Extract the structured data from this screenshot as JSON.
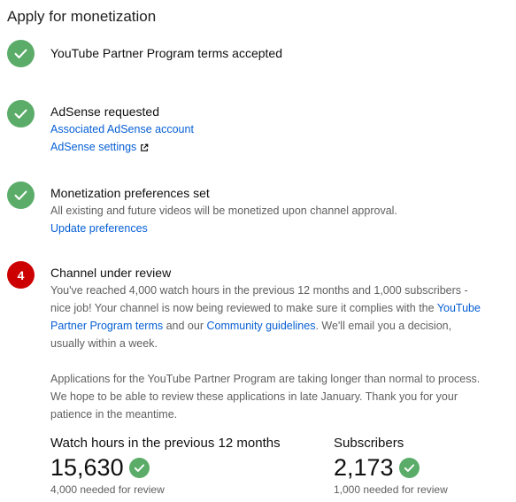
{
  "page": {
    "title": "Apply for monetization"
  },
  "colors": {
    "done": "#5bac69",
    "current": "#cc0000",
    "link": "#065fd4"
  },
  "steps": [
    {
      "status": "done",
      "icon": "check-icon",
      "title": "YouTube Partner Program terms accepted"
    },
    {
      "status": "done",
      "icon": "check-icon",
      "title": "AdSense requested",
      "links": [
        "Associated AdSense account",
        "AdSense settings"
      ]
    },
    {
      "status": "done",
      "icon": "check-icon",
      "title": "Monetization preferences set",
      "description": "All existing and future videos will be monetized upon channel approval.",
      "link": "Update preferences"
    },
    {
      "status": "current",
      "number": "4",
      "title": "Channel under review",
      "para1_part1": "You've reached 4,000 watch hours in the previous 12 months and 1,000 subscribers - nice job! Your channel is now being reviewed to make sure it complies with the ",
      "para1_link1": "YouTube Partner Program terms",
      "para1_part2": " and our ",
      "para1_link2": "Community guidelines",
      "para1_part3": ". We'll email you a decision, usually within a week.",
      "para2": "Applications for the YouTube Partner Program are taking longer than normal to process. We hope to be able to review these applications in late January. Thank you for your patience in the meantime."
    }
  ],
  "stats": {
    "watch_hours": {
      "label": "Watch hours in the previous 12 months",
      "value": "15,630",
      "note": "4,000 needed for review"
    },
    "subscribers": {
      "label": "Subscribers",
      "value": "2,173",
      "note": "1,000 needed for review"
    }
  }
}
